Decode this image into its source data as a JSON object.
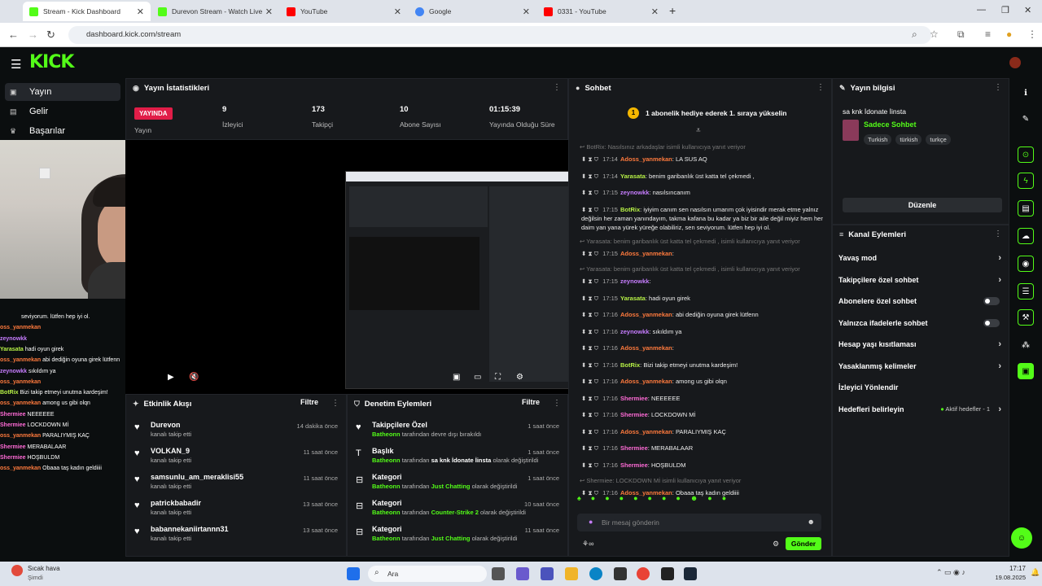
{
  "browser": {
    "tabs": [
      {
        "title": "Stream - Kick Dashboard",
        "color": "#53fc18"
      },
      {
        "title": "Durevon Stream - Watch Live o",
        "color": "#53fc18"
      },
      {
        "title": "YouTube",
        "color": "#ff0000"
      },
      {
        "title": "Google",
        "color": "#4285f4"
      },
      {
        "title": "0331 - YouTube",
        "color": "#ff0000"
      }
    ],
    "url": "dashboard.kick.com/stream"
  },
  "logo": "KICK",
  "left_nav": [
    {
      "label": "Yayın",
      "icon": "broadcast-icon"
    },
    {
      "label": "Gelir",
      "icon": "money-icon"
    },
    {
      "label": "Başarılar",
      "icon": "trophy-icon"
    }
  ],
  "stats_panel": {
    "title": "Yayın İstatistikleri",
    "live_badge": "YAYINDA",
    "live_label": "Yayın",
    "items": [
      {
        "value": "9",
        "label": "İzleyici"
      },
      {
        "value": "173",
        "label": "Takipçi"
      },
      {
        "value": "10",
        "label": "Abone Sayısı"
      },
      {
        "value": "01:15:39",
        "label": "Yayında Olduğu Süre"
      }
    ]
  },
  "activity_feed": {
    "title": "Etkinlik Akışı",
    "filter": "Filtre",
    "items": [
      {
        "name": "Durevon",
        "sub": "kanalı takip etti",
        "time": "14 dakika önce"
      },
      {
        "name": "VOLKAN_9",
        "sub": "kanalı takip etti",
        "time": "11 saat önce"
      },
      {
        "name": "samsunlu_am_meraklisi55",
        "sub": "kanalı takip etti",
        "time": "11 saat önce"
      },
      {
        "name": "patrickbabadir",
        "sub": "kanalı takip etti",
        "time": "13 saat önce"
      },
      {
        "name": "babannekaniirtannn31",
        "sub": "kanalı takip etti",
        "time": "13 saat önce"
      }
    ]
  },
  "moderation": {
    "title": "Denetim Eylemleri",
    "filter": "Filtre",
    "items": [
      {
        "name": "Takipçilere Özel",
        "who": "Batheonn",
        "mid": "tarafından devre dışı bırakıldı",
        "val": "",
        "end": "",
        "time": "1 saat önce"
      },
      {
        "name": "Başlık",
        "who": "Batheonn",
        "mid": "tarafından",
        "val": "sa knk İdonate İinsta",
        "end": "olarak değiştirildi",
        "time": "1 saat önce"
      },
      {
        "name": "Kategori",
        "who": "Batheonn",
        "mid": "tarafından",
        "val": "Just Chatting",
        "end": "olarak değiştirildi",
        "time": "1 saat önce"
      },
      {
        "name": "Kategori",
        "who": "Batheonn",
        "mid": "tarafından",
        "val": "Counter-Strike 2",
        "end": "olarak değiştirildi",
        "time": "10 saat önce"
      },
      {
        "name": "Kategori",
        "who": "Batheonn",
        "mid": "tarafından",
        "val": "Just Chatting",
        "end": "olarak değiştirildi",
        "time": "11 saat önce"
      }
    ]
  },
  "chat": {
    "title": "Sohbet",
    "pinned": "1 abonelik hediye ederek 1. sıraya yükselin",
    "input_placeholder": "Bir mesaj gönderin",
    "send": "Gönder",
    "messages": [
      {
        "reply": "BotRix: Nasılsınız arkadaşlar isimli kullanıcıya yanıt veriyor"
      },
      {
        "time": "17:14",
        "user": "Adoss_yanmekan",
        "style": "u",
        "text": "LA SUS AQ"
      },
      {
        "time": "17:14",
        "user": "Yarasata",
        "style": "gr",
        "text": "benim garibanlık üst katta tel çekmedi ,"
      },
      {
        "time": "17:15",
        "user": "zeynowkk",
        "style": "cy",
        "text": "nasılsıncanım"
      },
      {
        "time": "17:15",
        "user": "BotRix",
        "style": "gr",
        "text": "iyiyim canım sen nasılsın umarım çok iyisindir merak etme yalnız değilsin her zaman yanındayım, takma kafana bu kadar ya biz bir aile değil miyiz hem her daim yan yana yürek yüreğe olabiliriz, sen seviyorum. lütfen hep iyi ol."
      },
      {
        "reply": "Yarasata: benim garibanlık üst katta tel çekmedi , isimli kullanıcıya yanıt veriyor"
      },
      {
        "time": "17:15",
        "user": "Adoss_yanmekan",
        "style": "u",
        "text": ""
      },
      {
        "reply": "Yarasata: benim garibanlık üst katta tel çekmedi , isimli kullanıcıya yanıt veriyor"
      },
      {
        "time": "17:15",
        "user": "zeynowkk",
        "style": "cy",
        "text": ""
      },
      {
        "time": "17:15",
        "user": "Yarasata",
        "style": "gr",
        "text": "hadi oyun girek"
      },
      {
        "time": "17:16",
        "user": "Adoss_yanmekan",
        "style": "u",
        "text": "abi dediğin oyuna girek lütfenn"
      },
      {
        "time": "17:16",
        "user": "zeynowkk",
        "style": "cy",
        "text": "sıkıldım ya"
      },
      {
        "time": "17:16",
        "user": "Adoss_yanmekan",
        "style": "u",
        "text": ""
      },
      {
        "time": "17:16",
        "user": "BotRix",
        "style": "gr",
        "text": "Bizi takip etmeyi unutma kardeşim!"
      },
      {
        "time": "17:16",
        "user": "Adoss_yanmekan",
        "style": "u",
        "text": "among us gibi olqn"
      },
      {
        "time": "17:16",
        "user": "Shermiee",
        "style": "pk",
        "text": "NEEEEEE"
      },
      {
        "time": "17:16",
        "user": "Shermiee",
        "style": "pk",
        "text": "LOCKDOWN Mİ"
      },
      {
        "time": "17:16",
        "user": "Adoss_yanmekan",
        "style": "u",
        "text": "PARALIYMIŞ KAÇ"
      },
      {
        "time": "17:16",
        "user": "Shermiee",
        "style": "pk",
        "text": "MERABALAAR"
      },
      {
        "time": "17:16",
        "user": "Shermiee",
        "style": "pk",
        "text": "HOŞBULDM"
      },
      {
        "reply": "Shermiee: LOCKDOWN Mİ isimli kullanıcıya yanıt veriyor"
      },
      {
        "time": "17:16",
        "user": "Adoss_yanmekan",
        "style": "u",
        "text": "Obaaa taş kadın geldiiii"
      }
    ]
  },
  "stream_info": {
    "title": "Yayın bilgisi",
    "stream_title": "sa knk İdonate İinsta",
    "category": "Sadece Sohbet",
    "tags": [
      "Turkish",
      "türkish",
      "turkçe"
    ],
    "edit": "Düzenle"
  },
  "channel_actions": {
    "title": "Kanal Eylemleri",
    "items": [
      {
        "label": "Yavaş mod",
        "kind": "chev"
      },
      {
        "label": "Takipçilere özel sohbet",
        "kind": "chev"
      },
      {
        "label": "Abonelere özel sohbet",
        "kind": "toggle"
      },
      {
        "label": "Yalnızca ifadelerle sohbet",
        "kind": "toggle"
      },
      {
        "label": "Hesap yaşı kısıtlaması",
        "kind": "chev"
      },
      {
        "label": "Yasaklanmış kelimeler",
        "kind": "chev"
      },
      {
        "label": "İzleyici Yönlendir",
        "kind": "none"
      },
      {
        "label": "Hedefleri belirleyin",
        "kind": "chev"
      }
    ],
    "goals_status": "Aktif hedefler - 1"
  },
  "overlay_chat": [
    {
      "user": "",
      "text": "seviyorum. lütfen hep iyi ol."
    },
    {
      "user": "oss_yanmekan",
      "style": "u",
      "text": ""
    },
    {
      "user": "zeynowkk",
      "style": "cy",
      "text": ""
    },
    {
      "user": "Yarasata",
      "style": "gr",
      "text": "hadi oyun girek"
    },
    {
      "user": "oss_yanmekan",
      "style": "u",
      "text": "abi dediğin oyuna girek lütfenn"
    },
    {
      "user": "zeynowkk",
      "style": "cy",
      "text": "sıkıldım ya"
    },
    {
      "user": "oss_yanmekan",
      "style": "u",
      "text": ""
    },
    {
      "user": "BotRix",
      "style": "gr",
      "text": "Bizi takip etmeyi unutma kardeşim!"
    },
    {
      "user": "oss_yanmekan",
      "style": "u",
      "text": "among us gibi olqn"
    },
    {
      "user": "Shermiee",
      "style": "pk",
      "text": "NEEEEEE"
    },
    {
      "user": "Shermiee",
      "style": "pk",
      "text": "LOCKDOWN Mİ"
    },
    {
      "user": "oss_yanmekan",
      "style": "u",
      "text": "PARALIYMIŞ KAÇ"
    },
    {
      "user": "Shermiee",
      "style": "pk",
      "text": "MERABALAAR"
    },
    {
      "user": "Shermiee",
      "style": "pk",
      "text": "HOŞBULDM"
    },
    {
      "user": "oss_yanmekan",
      "style": "u",
      "text": "Obaaa taş kadın geldiiii"
    }
  ],
  "taskbar": {
    "weather": "Sıcak hava",
    "weather_sub": "Şimdi",
    "search": "Ara",
    "time": "17:17",
    "date": "19.08.2025"
  }
}
